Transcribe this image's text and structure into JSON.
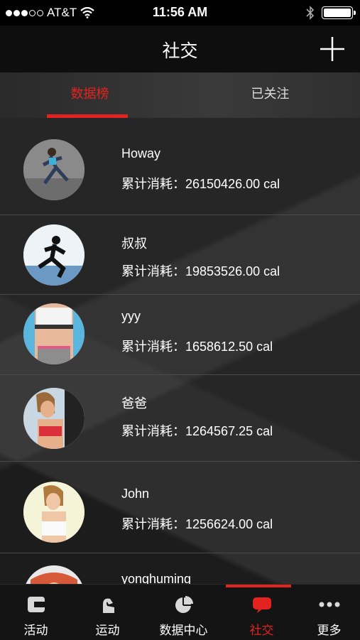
{
  "status_bar": {
    "carrier": "AT&T",
    "time": "11:56 AM",
    "signal_bars_filled": 3,
    "signal_bars_total": 5
  },
  "nav": {
    "title": "社交",
    "add_icon": "plus-icon"
  },
  "tabs": {
    "active_label": "数据榜",
    "inactive_label": "已关注"
  },
  "rows": [
    {
      "name": "Howay",
      "calories": "累计消耗：26150426.00 cal"
    },
    {
      "name": "叔叔",
      "calories": "累计消耗：19853526.00 cal"
    },
    {
      "name": "yyy",
      "calories": "累计消耗：1658612.50 cal"
    },
    {
      "name": "爸爸",
      "calories": "累计消耗：1264567.25 cal"
    },
    {
      "name": "John",
      "calories": "累计消耗：1256624.00 cal"
    },
    {
      "name": "yonghuming",
      "calories": ""
    }
  ],
  "tabbar": {
    "items": [
      {
        "label": "活动",
        "icon": "activity-c-icon"
      },
      {
        "label": "运动",
        "icon": "sport-icon"
      },
      {
        "label": "数据中心",
        "icon": "pie-chart-icon"
      },
      {
        "label": "社交",
        "icon": "chat-bubble-icon"
      },
      {
        "label": "更多",
        "icon": "more-dots-icon"
      }
    ]
  },
  "colors": {
    "accent": "#e3231f",
    "background": "#1c1c1c"
  }
}
